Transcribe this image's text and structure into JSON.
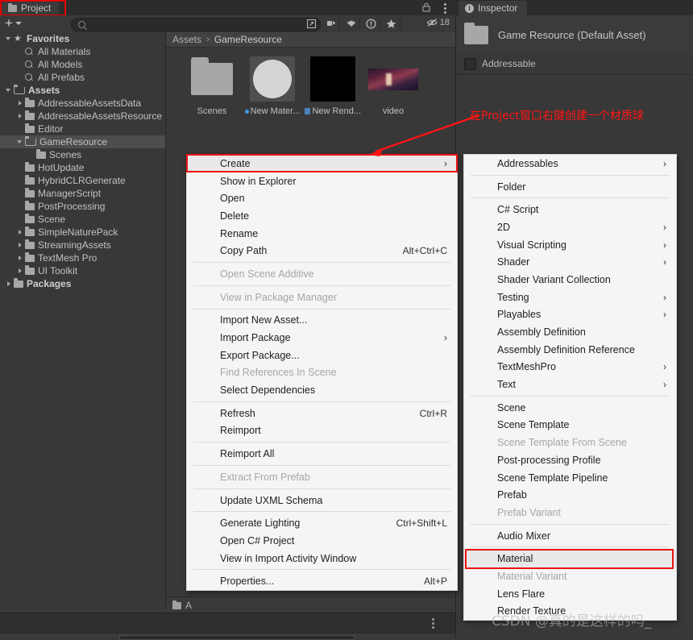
{
  "project_panel": {
    "tab_label": "Project",
    "tab_icon": "folder-icon",
    "lock_icon": "lock-icon",
    "menu_icon": "kebab-menu-icon",
    "toolbar": {
      "add_label": "+",
      "search_placeholder": "",
      "search_value": "",
      "hidden_count": "18",
      "buttons": [
        "save-search-icon",
        "filter-type-icon",
        "filter-label-icon",
        "filter-warning-icon",
        "filter-favorite-icon"
      ]
    },
    "breadcrumb": {
      "root": "Assets",
      "separator": ">",
      "current": "GameResource"
    },
    "tree": [
      {
        "label": "Favorites",
        "depth": 0,
        "arrow": "down",
        "icon": "star-icon",
        "bold": true,
        "selected": false
      },
      {
        "label": "All Materials",
        "depth": 1,
        "arrow": "none",
        "icon": "search-icon",
        "bold": false,
        "selected": false
      },
      {
        "label": "All Models",
        "depth": 1,
        "arrow": "none",
        "icon": "search-icon",
        "bold": false,
        "selected": false
      },
      {
        "label": "All Prefabs",
        "depth": 1,
        "arrow": "none",
        "icon": "search-icon",
        "bold": false,
        "selected": false
      },
      {
        "label": "Assets",
        "depth": 0,
        "arrow": "down",
        "icon": "folder-open-icon",
        "bold": true,
        "selected": false
      },
      {
        "label": "AddressableAssetsData",
        "depth": 1,
        "arrow": "right",
        "icon": "folder-icon",
        "bold": false,
        "selected": false
      },
      {
        "label": "AddressableAssetsResource",
        "depth": 1,
        "arrow": "right",
        "icon": "folder-icon",
        "bold": false,
        "selected": false
      },
      {
        "label": "Editor",
        "depth": 1,
        "arrow": "none",
        "icon": "folder-icon",
        "bold": false,
        "selected": false
      },
      {
        "label": "GameResource",
        "depth": 1,
        "arrow": "down",
        "icon": "folder-open-icon",
        "bold": false,
        "selected": true
      },
      {
        "label": "Scenes",
        "depth": 2,
        "arrow": "none",
        "icon": "folder-icon",
        "bold": false,
        "selected": false
      },
      {
        "label": "HotUpdate",
        "depth": 1,
        "arrow": "none",
        "icon": "folder-icon",
        "bold": false,
        "selected": false
      },
      {
        "label": "HybridCLRGenerate",
        "depth": 1,
        "arrow": "none",
        "icon": "folder-icon",
        "bold": false,
        "selected": false
      },
      {
        "label": "ManagerScript",
        "depth": 1,
        "arrow": "none",
        "icon": "folder-icon",
        "bold": false,
        "selected": false
      },
      {
        "label": "PostProcessing",
        "depth": 1,
        "arrow": "none",
        "icon": "folder-icon",
        "bold": false,
        "selected": false
      },
      {
        "label": "Scene",
        "depth": 1,
        "arrow": "none",
        "icon": "folder-icon",
        "bold": false,
        "selected": false
      },
      {
        "label": "SimpleNaturePack",
        "depth": 1,
        "arrow": "right",
        "icon": "folder-icon",
        "bold": false,
        "selected": false
      },
      {
        "label": "StreamingAssets",
        "depth": 1,
        "arrow": "right",
        "icon": "folder-icon",
        "bold": false,
        "selected": false
      },
      {
        "label": "TextMesh Pro",
        "depth": 1,
        "arrow": "right",
        "icon": "folder-icon",
        "bold": false,
        "selected": false
      },
      {
        "label": "UI Toolkit",
        "depth": 1,
        "arrow": "right",
        "icon": "folder-icon",
        "bold": false,
        "selected": false
      },
      {
        "label": "Packages",
        "depth": 0,
        "arrow": "right",
        "icon": "folder-icon",
        "bold": true,
        "selected": false
      }
    ],
    "assets": [
      {
        "label": "Scenes",
        "thumb": "folder",
        "badge": ""
      },
      {
        "label": "New Mater...",
        "thumb": "material",
        "badge": "dot-blue"
      },
      {
        "label": "New Rend...",
        "thumb": "render-texture",
        "badge": "render-texture-icon"
      },
      {
        "label": "video",
        "thumb": "video",
        "badge": ""
      }
    ],
    "bottom_item": "A"
  },
  "inspector": {
    "tab_label": "Inspector",
    "tab_icon": "info-icon",
    "asset_title": "Game Resource (Default Asset)",
    "asset_icon": "folder-icon",
    "addressable_label": "Addressable",
    "addressable_checked": false
  },
  "context_menu": {
    "items": [
      {
        "label": "Create",
        "shortcut": "",
        "submenu": true,
        "disabled": false,
        "highlighted": true
      },
      {
        "label": "Show in Explorer",
        "shortcut": "",
        "submenu": false,
        "disabled": false
      },
      {
        "label": "Open",
        "shortcut": "",
        "submenu": false,
        "disabled": false
      },
      {
        "label": "Delete",
        "shortcut": "",
        "submenu": false,
        "disabled": false
      },
      {
        "label": "Rename",
        "shortcut": "",
        "submenu": false,
        "disabled": false
      },
      {
        "label": "Copy Path",
        "shortcut": "Alt+Ctrl+C",
        "submenu": false,
        "disabled": false
      },
      {
        "separator": true
      },
      {
        "label": "Open Scene Additive",
        "shortcut": "",
        "submenu": false,
        "disabled": true
      },
      {
        "separator": true
      },
      {
        "label": "View in Package Manager",
        "shortcut": "",
        "submenu": false,
        "disabled": true
      },
      {
        "separator": true
      },
      {
        "label": "Import New Asset...",
        "shortcut": "",
        "submenu": false,
        "disabled": false
      },
      {
        "label": "Import Package",
        "shortcut": "",
        "submenu": true,
        "disabled": false
      },
      {
        "label": "Export Package...",
        "shortcut": "",
        "submenu": false,
        "disabled": false
      },
      {
        "label": "Find References In Scene",
        "shortcut": "",
        "submenu": false,
        "disabled": true
      },
      {
        "label": "Select Dependencies",
        "shortcut": "",
        "submenu": false,
        "disabled": false
      },
      {
        "separator": true
      },
      {
        "label": "Refresh",
        "shortcut": "Ctrl+R",
        "submenu": false,
        "disabled": false
      },
      {
        "label": "Reimport",
        "shortcut": "",
        "submenu": false,
        "disabled": false
      },
      {
        "separator": true
      },
      {
        "label": "Reimport All",
        "shortcut": "",
        "submenu": false,
        "disabled": false
      },
      {
        "separator": true
      },
      {
        "label": "Extract From Prefab",
        "shortcut": "",
        "submenu": false,
        "disabled": true
      },
      {
        "separator": true
      },
      {
        "label": "Update UXML Schema",
        "shortcut": "",
        "submenu": false,
        "disabled": false
      },
      {
        "separator": true
      },
      {
        "label": "Generate Lighting",
        "shortcut": "Ctrl+Shift+L",
        "submenu": false,
        "disabled": false
      },
      {
        "label": "Open C# Project",
        "shortcut": "",
        "submenu": false,
        "disabled": false
      },
      {
        "label": "View in Import Activity Window",
        "shortcut": "",
        "submenu": false,
        "disabled": false
      },
      {
        "separator": true
      },
      {
        "label": "Properties...",
        "shortcut": "Alt+P",
        "submenu": false,
        "disabled": false
      }
    ]
  },
  "create_submenu": {
    "items": [
      {
        "label": "Addressables",
        "submenu": true,
        "disabled": false
      },
      {
        "separator": true
      },
      {
        "label": "Folder",
        "submenu": false,
        "disabled": false
      },
      {
        "separator": true
      },
      {
        "label": "C# Script",
        "submenu": false,
        "disabled": false
      },
      {
        "label": "2D",
        "submenu": true,
        "disabled": false
      },
      {
        "label": "Visual Scripting",
        "submenu": true,
        "disabled": false
      },
      {
        "label": "Shader",
        "submenu": true,
        "disabled": false
      },
      {
        "label": "Shader Variant Collection",
        "submenu": false,
        "disabled": false
      },
      {
        "label": "Testing",
        "submenu": true,
        "disabled": false
      },
      {
        "label": "Playables",
        "submenu": true,
        "disabled": false
      },
      {
        "label": "Assembly Definition",
        "submenu": false,
        "disabled": false
      },
      {
        "label": "Assembly Definition Reference",
        "submenu": false,
        "disabled": false
      },
      {
        "label": "TextMeshPro",
        "submenu": true,
        "disabled": false
      },
      {
        "label": "Text",
        "submenu": true,
        "disabled": false
      },
      {
        "separator": true
      },
      {
        "label": "Scene",
        "submenu": false,
        "disabled": false
      },
      {
        "label": "Scene Template",
        "submenu": false,
        "disabled": false
      },
      {
        "label": "Scene Template From Scene",
        "submenu": false,
        "disabled": true
      },
      {
        "label": "Post-processing Profile",
        "submenu": false,
        "disabled": false
      },
      {
        "label": "Scene Template Pipeline",
        "submenu": false,
        "disabled": false
      },
      {
        "label": "Prefab",
        "submenu": false,
        "disabled": false
      },
      {
        "label": "Prefab Variant",
        "submenu": false,
        "disabled": true
      },
      {
        "separator": true
      },
      {
        "label": "Audio Mixer",
        "submenu": false,
        "disabled": false
      },
      {
        "separator": true
      },
      {
        "label": "Material",
        "submenu": false,
        "disabled": false,
        "highlighted": true
      },
      {
        "label": "Material Variant",
        "submenu": false,
        "disabled": true
      },
      {
        "label": "Lens Flare",
        "submenu": false,
        "disabled": false
      },
      {
        "label": "Render Texture",
        "submenu": false,
        "disabled": false
      }
    ]
  },
  "annotation": {
    "text": "在Project窗口右键创建一个材质球",
    "color": "#ff1414",
    "arrow": "red-arrow-pointing-to-create"
  },
  "watermark": {
    "text": "CSDN @真的是这样的吗_"
  }
}
